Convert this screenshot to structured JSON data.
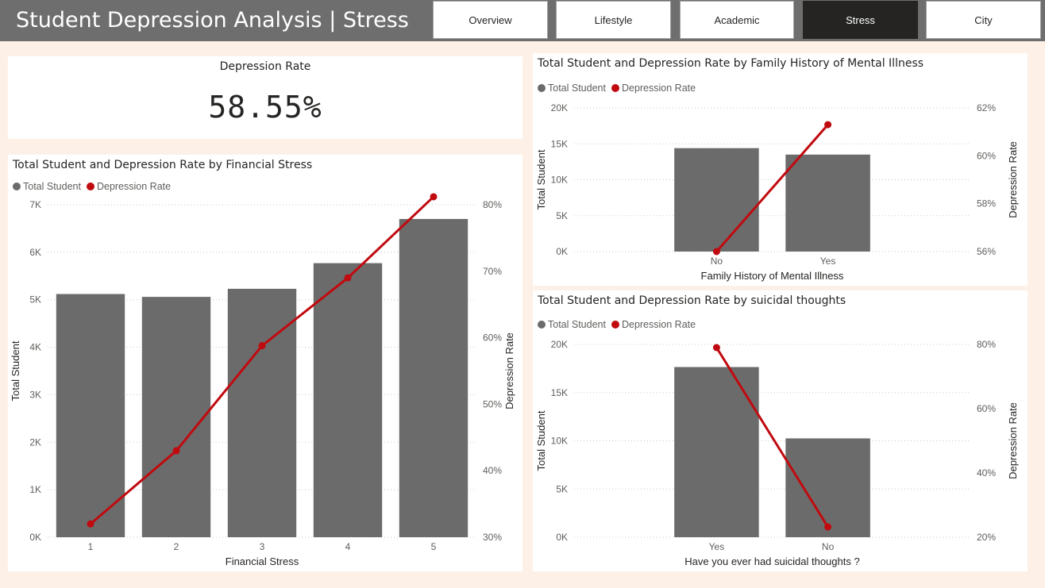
{
  "header": {
    "title": "Student Depression Analysis | Stress",
    "nav": [
      {
        "label": "Overview",
        "active": false
      },
      {
        "label": "Lifestyle",
        "active": false
      },
      {
        "label": "Academic",
        "active": false
      },
      {
        "label": "Stress",
        "active": true
      },
      {
        "label": "City",
        "active": false
      }
    ]
  },
  "kpi": {
    "label": "Depression Rate",
    "value": "58.55%"
  },
  "colors": {
    "bar": "#6b6b6b",
    "line": "#c00a0f",
    "grid": "#c8c8c8",
    "text": "#605e5c",
    "title": "#252423"
  },
  "legend": {
    "bar_label": "Total Student",
    "line_label": "Depression Rate"
  },
  "chart_data": [
    {
      "type": "bar",
      "title": "Total Student and Depression Rate by Financial Stress",
      "xlabel": "Financial Stress",
      "ylabel": "Total Student",
      "y2label": "Depression Rate",
      "categories": [
        "1",
        "2",
        "3",
        "4",
        "5"
      ],
      "series": [
        {
          "name": "Total Student",
          "type": "bar",
          "values": [
            5120,
            5060,
            5230,
            5770,
            6700
          ]
        },
        {
          "name": "Depression Rate",
          "type": "line",
          "axis": "right",
          "values": [
            32.0,
            43.0,
            58.8,
            69.0,
            81.2
          ]
        }
      ],
      "ylim": [
        0,
        7000
      ],
      "yticks": [
        0,
        1000,
        2000,
        3000,
        4000,
        5000,
        6000,
        7000
      ],
      "ytick_labels": [
        "0K",
        "1K",
        "2K",
        "3K",
        "4K",
        "5K",
        "6K",
        "7K"
      ],
      "y2lim": [
        30,
        80
      ],
      "y2ticks": [
        30,
        40,
        50,
        60,
        70,
        80
      ],
      "y2tick_labels": [
        "30%",
        "40%",
        "50%",
        "60%",
        "70%",
        "80%"
      ],
      "legend_position": "top-left",
      "grid": true
    },
    {
      "type": "bar",
      "title": "Total Student and Depression Rate by Family History of Mental Illness",
      "xlabel": "Family History of Mental Illness",
      "ylabel": "Total Student",
      "y2label": "Depression Rate",
      "categories": [
        "No",
        "Yes"
      ],
      "series": [
        {
          "name": "Total Student",
          "type": "bar",
          "values": [
            14400,
            13500
          ]
        },
        {
          "name": "Depression Rate",
          "type": "line",
          "axis": "right",
          "values": [
            56.0,
            61.3
          ]
        }
      ],
      "ylim": [
        0,
        20000
      ],
      "yticks": [
        0,
        5000,
        10000,
        15000,
        20000
      ],
      "ytick_labels": [
        "0K",
        "5K",
        "10K",
        "15K",
        "20K"
      ],
      "y2lim": [
        56,
        62
      ],
      "y2ticks": [
        56,
        58,
        60,
        62
      ],
      "y2tick_labels": [
        "56%",
        "58%",
        "60%",
        "62%"
      ],
      "legend_position": "top-left",
      "grid": true
    },
    {
      "type": "bar",
      "title": "Total Student and Depression Rate by suicidal thoughts",
      "xlabel": "Have you ever had suicidal thoughts ?",
      "ylabel": "Total Student",
      "y2label": "Depression Rate",
      "categories": [
        "Yes",
        "No"
      ],
      "series": [
        {
          "name": "Total Student",
          "type": "bar",
          "values": [
            17650,
            10250
          ]
        },
        {
          "name": "Depression Rate",
          "type": "line",
          "axis": "right",
          "values": [
            79.0,
            23.2
          ]
        }
      ],
      "ylim": [
        0,
        20000
      ],
      "yticks": [
        0,
        5000,
        10000,
        15000,
        20000
      ],
      "ytick_labels": [
        "0K",
        "5K",
        "10K",
        "15K",
        "20K"
      ],
      "y2lim": [
        20,
        80
      ],
      "y2ticks": [
        20,
        40,
        60,
        80
      ],
      "y2tick_labels": [
        "20%",
        "40%",
        "60%",
        "80%"
      ],
      "legend_position": "top-left",
      "grid": true
    }
  ]
}
